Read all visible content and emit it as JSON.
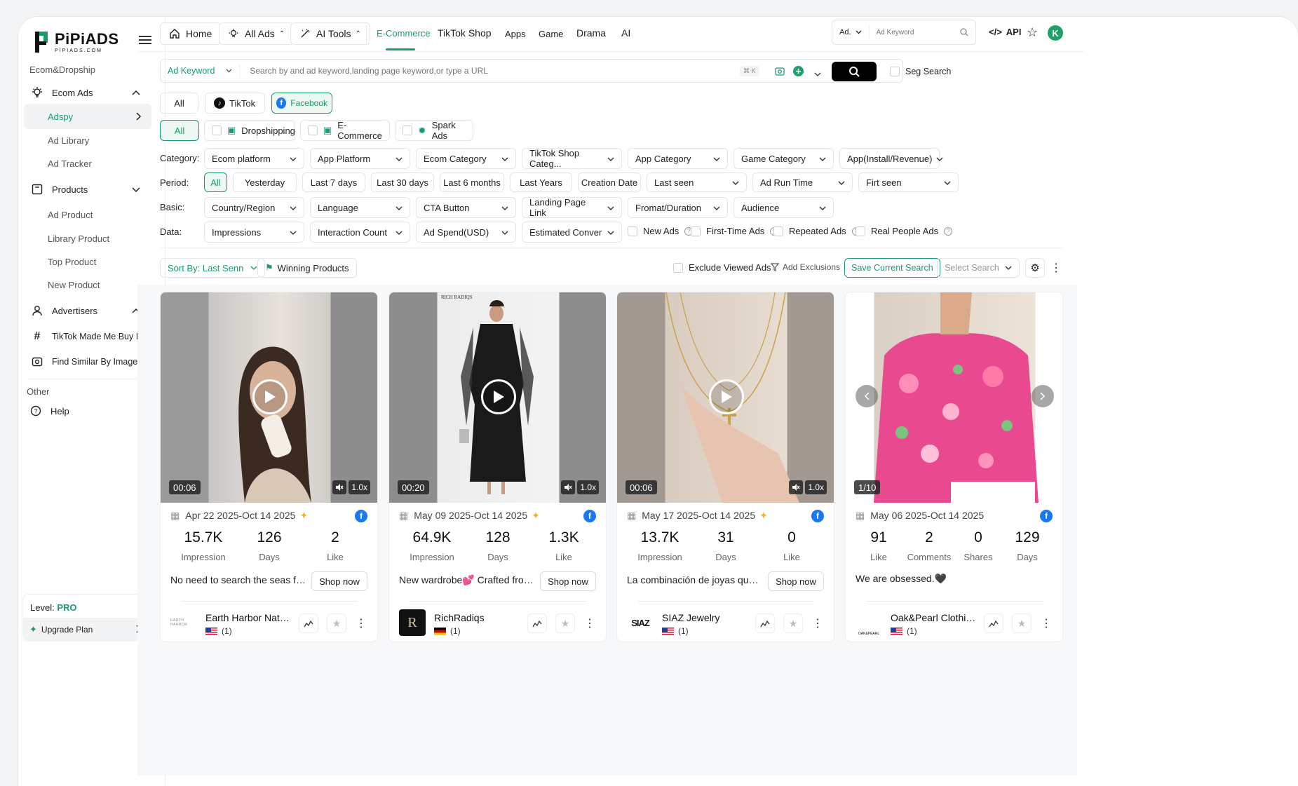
{
  "brand": {
    "name": "PiPiADS",
    "sub": "PIPIADS.COM",
    "accent": "#1a9b6b"
  },
  "sidebar": {
    "section1": "Ecom&Dropship",
    "ecom_ads": "Ecom Ads",
    "ecom_sub": [
      "Adspy",
      "Ad Library",
      "Ad Tracker"
    ],
    "products": "Products",
    "products_sub": [
      "Ad Product",
      "Library Product",
      "Top Product",
      "New Product"
    ],
    "advertisers": "Advertisers",
    "tiktok_made": "TikTok Made Me Buy It",
    "find_similar": "Find Similar By Image",
    "section2": "Other",
    "help": "Help",
    "level_label": "Level:",
    "level_value": "PRO",
    "upgrade": "Upgrade Plan"
  },
  "topbar": {
    "home": "Home",
    "all_ads": "All Ads",
    "ai_tools": "AI Tools",
    "nav": [
      "E-Commerce",
      "TikTok Shop",
      "Apps",
      "Game",
      "Drama",
      "AI"
    ],
    "search_type": "Ad.",
    "search_placeholder": "Ad Keyword",
    "api": "API",
    "avatar": "K"
  },
  "search": {
    "type": "Ad Keyword",
    "placeholder": "Search by and ad keyword,landing page keyword,or type a URL",
    "shortcut": "⌘ K",
    "seg": "Seg Search"
  },
  "platforms": [
    "All",
    "TikTok",
    "Facebook"
  ],
  "types": [
    "All",
    "Dropshipping",
    "E-Commerce",
    "Spark Ads"
  ],
  "filters": {
    "category_label": "Category:",
    "category": [
      "Ecom platform",
      "App Platform",
      "Ecom Category",
      "TikTok Shop Categ...",
      "App Category",
      "Game Category",
      "App(Install/Revenue)"
    ],
    "period_label": "Period:",
    "period": [
      "All",
      "Yesterday",
      "Last 7 days",
      "Last 30 days",
      "Last 6 months",
      "Last Years",
      "Creation Date",
      "Last seen",
      "Ad Run Time",
      "Firt seen"
    ],
    "basic_label": "Basic:",
    "basic": [
      "Country/Region",
      "Language",
      "CTA Button",
      "Landing Page Link",
      "Fromat/Duration",
      "Audience"
    ],
    "data_label": "Data:",
    "data": [
      "Impressions",
      "Interaction Count",
      "Ad Spend(USD)",
      "Estimated Conver"
    ],
    "checks": [
      "New Ads",
      "First-Time Ads",
      "Repeated Ads",
      "Real People Ads"
    ]
  },
  "toolbar": {
    "sort": "Sort By: Last Senn",
    "winning": "Winning Products",
    "exclude": "Exclude Viewed Ads",
    "exclusions": "Add Exclusions",
    "save": "Save Current Search",
    "select": "Select Search"
  },
  "cards": [
    {
      "duration": "00:06",
      "speed": "1.0x",
      "date": "Apr 22 2025-Oct 14 2025",
      "stats": [
        {
          "v": "15.7K",
          "l": "Impression"
        },
        {
          "v": "126",
          "l": "Days"
        },
        {
          "v": "2",
          "l": "Like"
        }
      ],
      "desc": "No need to search the seas fo...",
      "cta": "Shop now",
      "advertiser": "Earth Harbor Natu...",
      "count": "(1)",
      "logo": "EARTH HARBOR"
    },
    {
      "duration": "00:20",
      "speed": "1.0x",
      "date": "May 09 2025-Oct 14 2025",
      "stats": [
        {
          "v": "64.9K",
          "l": "Impression"
        },
        {
          "v": "128",
          "l": "Days"
        },
        {
          "v": "1.3K",
          "l": "Like"
        }
      ],
      "desc": "New wardrobe💕 Crafted from...",
      "cta": "Shop now",
      "advertiser": "RichRadiqs",
      "count": "(1)",
      "logo": "R",
      "media_label": "RICH RADIQS"
    },
    {
      "duration": "00:06",
      "speed": "1.0x",
      "date": "May 17 2025-Oct 14 2025",
      "stats": [
        {
          "v": "13.7K",
          "l": "Impression"
        },
        {
          "v": "31",
          "l": "Days"
        },
        {
          "v": "0",
          "l": "Like"
        }
      ],
      "desc": "La combinación de joyas que ...",
      "cta": "Shop now",
      "advertiser": "SIAZ Jewelry",
      "count": "(1)",
      "logo": "SIAZ"
    },
    {
      "duration": "1/10",
      "date": "May 06 2025-Oct 14 2025",
      "stats": [
        {
          "v": "91",
          "l": "Like"
        },
        {
          "v": "2",
          "l": "Comments"
        },
        {
          "v": "0",
          "l": "Shares"
        },
        {
          "v": "129",
          "l": "Days"
        }
      ],
      "desc": "We are obsessed.🖤",
      "advertiser": "Oak&Pearl Clothin...",
      "count": "(1)",
      "logo": "OAK&PEARL"
    }
  ]
}
